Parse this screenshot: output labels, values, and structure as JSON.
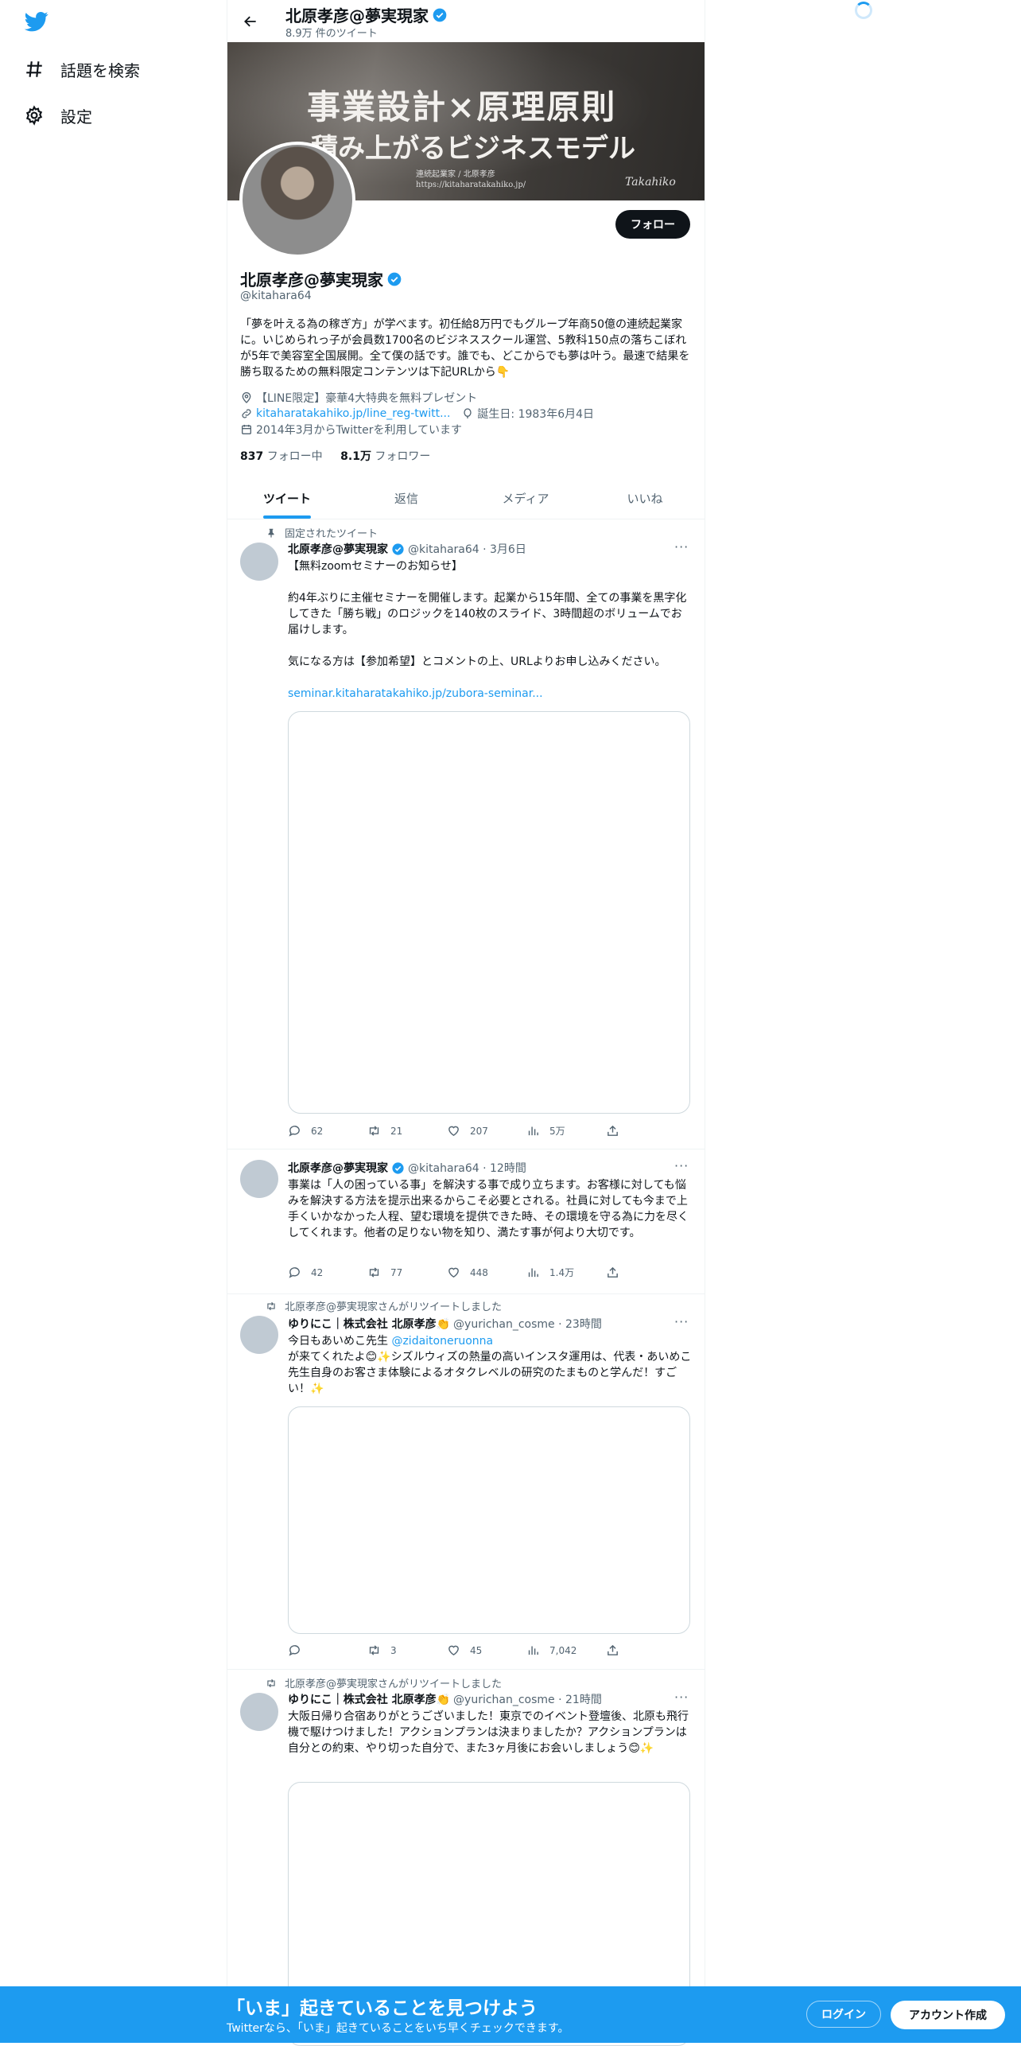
{
  "nav": {
    "items": [
      {
        "label": "話題を検索",
        "icon": "hashtag-icon"
      },
      {
        "label": "設定",
        "icon": "gear-icon"
      }
    ]
  },
  "header": {
    "name": "北原孝彦@夢実現家",
    "tweet_count": "8.9万 件のツイート"
  },
  "banner": {
    "line1": "事業設計×原理原則",
    "line2": "積み上がるビジネスモデル",
    "line3a": "連続起業家 / 北原孝彦",
    "line3b": "https://kitaharatakahiko.jp/",
    "signature": "Takahiko"
  },
  "profile": {
    "follow_label": "フォロー",
    "name": "北原孝彦@夢実現家",
    "handle": "@kitahara64",
    "bio": "「夢を叶える為の稼ぎ方」が学べます。初任給8万円でもグループ年商50億の連続起業家に。いじめられっ子が会員数1700名のビジネススクール運営、5教科150点の落ちこぼれが5年で美容室全国展開。全て僕の話です。誰でも、どこからでも夢は叶う。最速で結果を勝ち取るための無料限定コンテンツは下記URLから👇",
    "location": "【LINE限定】豪華4大特典を無料プレゼント",
    "url": "kitaharatakahiko.jp/line_reg-twitt...",
    "birthday": "誕生日: 1983年6月4日",
    "joined": "2014年3月からTwitterを利用しています",
    "following_count": "837",
    "following_label": "フォロー中",
    "followers_count": "8.1万",
    "followers_label": "フォロワー"
  },
  "tabs": [
    "ツイート",
    "返信",
    "メディア",
    "いいね"
  ],
  "tweets": [
    {
      "context": "固定されたツイート",
      "name": "北原孝彦@夢実現家",
      "meta": "@kitahara64 · 3月6日",
      "text": "【無料zoomセミナーのお知らせ】\n\n約4年ぶりに主催セミナーを開催します。起業から15年間、全ての事業を黒字化してきた「勝ち戦」のロジックを140枚のスライド、3時間超のボリュームでお届けします。\n\n気になる方は【参加希望】とコメントの上、URLよりお申し込みください。",
      "link": "seminar.kitaharatakahiko.jp/zubora-seminar...",
      "replies": "62",
      "retweets": "21",
      "likes": "207",
      "views": "5万"
    },
    {
      "name": "北原孝彦@夢実現家",
      "meta": "@kitahara64 · 12時間",
      "text": "事業は「人の困っている事」を解決する事で成り立ちます。お客様に対しても悩みを解決する方法を提示出来るからこそ必要とされる。社員に対しても今まで上手くいかなかった人程、望む環境を提供できた時、その環境を守る為に力を尽くしてくれます。他者の足りない物を知り、満たす事が何より大切です。",
      "replies": "42",
      "retweets": "77",
      "likes": "448",
      "views": "1.4万"
    },
    {
      "context": "北原孝彦@夢実現家さんがリツイートしました",
      "name": "ゆりにこ｜株式会社 北原孝彦👏",
      "meta": "@yurichan_cosme · 23時間",
      "text_a": "今日もあいめこ先生 ",
      "mention": "@zidaitoneruonna",
      "text_b": "が来てくれたよ😊✨シズルウィズの熱量の高いインスタ運用は、代表・あいめこ先生自身のお客さま体験によるオタクレベルの研究のたまものと学んだ！すごい！✨",
      "replies": "",
      "retweets": "3",
      "likes": "45",
      "views": "7,042"
    },
    {
      "context": "北原孝彦@夢実現家さんがリツイートしました",
      "name": "ゆりにこ｜株式会社 北原孝彦👏",
      "meta": "@yurichan_cosme · 21時間",
      "text": "大阪日帰り合宿ありがとうございました！東京でのイベント登壇後、北原も飛行機で駆けつけました！アクションプランは決まりましたか？アクションプランは自分との約束、やり切った自分で、また3ヶ月後にお会いしましょう😊✨"
    }
  ],
  "bottom": {
    "title": "「いま」起きていることを見つけよう",
    "subtitle": "Twitterなら、「いま」起きていることをいち早くチェックできます。",
    "login": "ログイン",
    "signup": "アカウント作成"
  },
  "colors": {
    "accent": "#1d9bf0",
    "text": "#0f1419",
    "muted": "#536471",
    "border": "#eff3f4"
  }
}
